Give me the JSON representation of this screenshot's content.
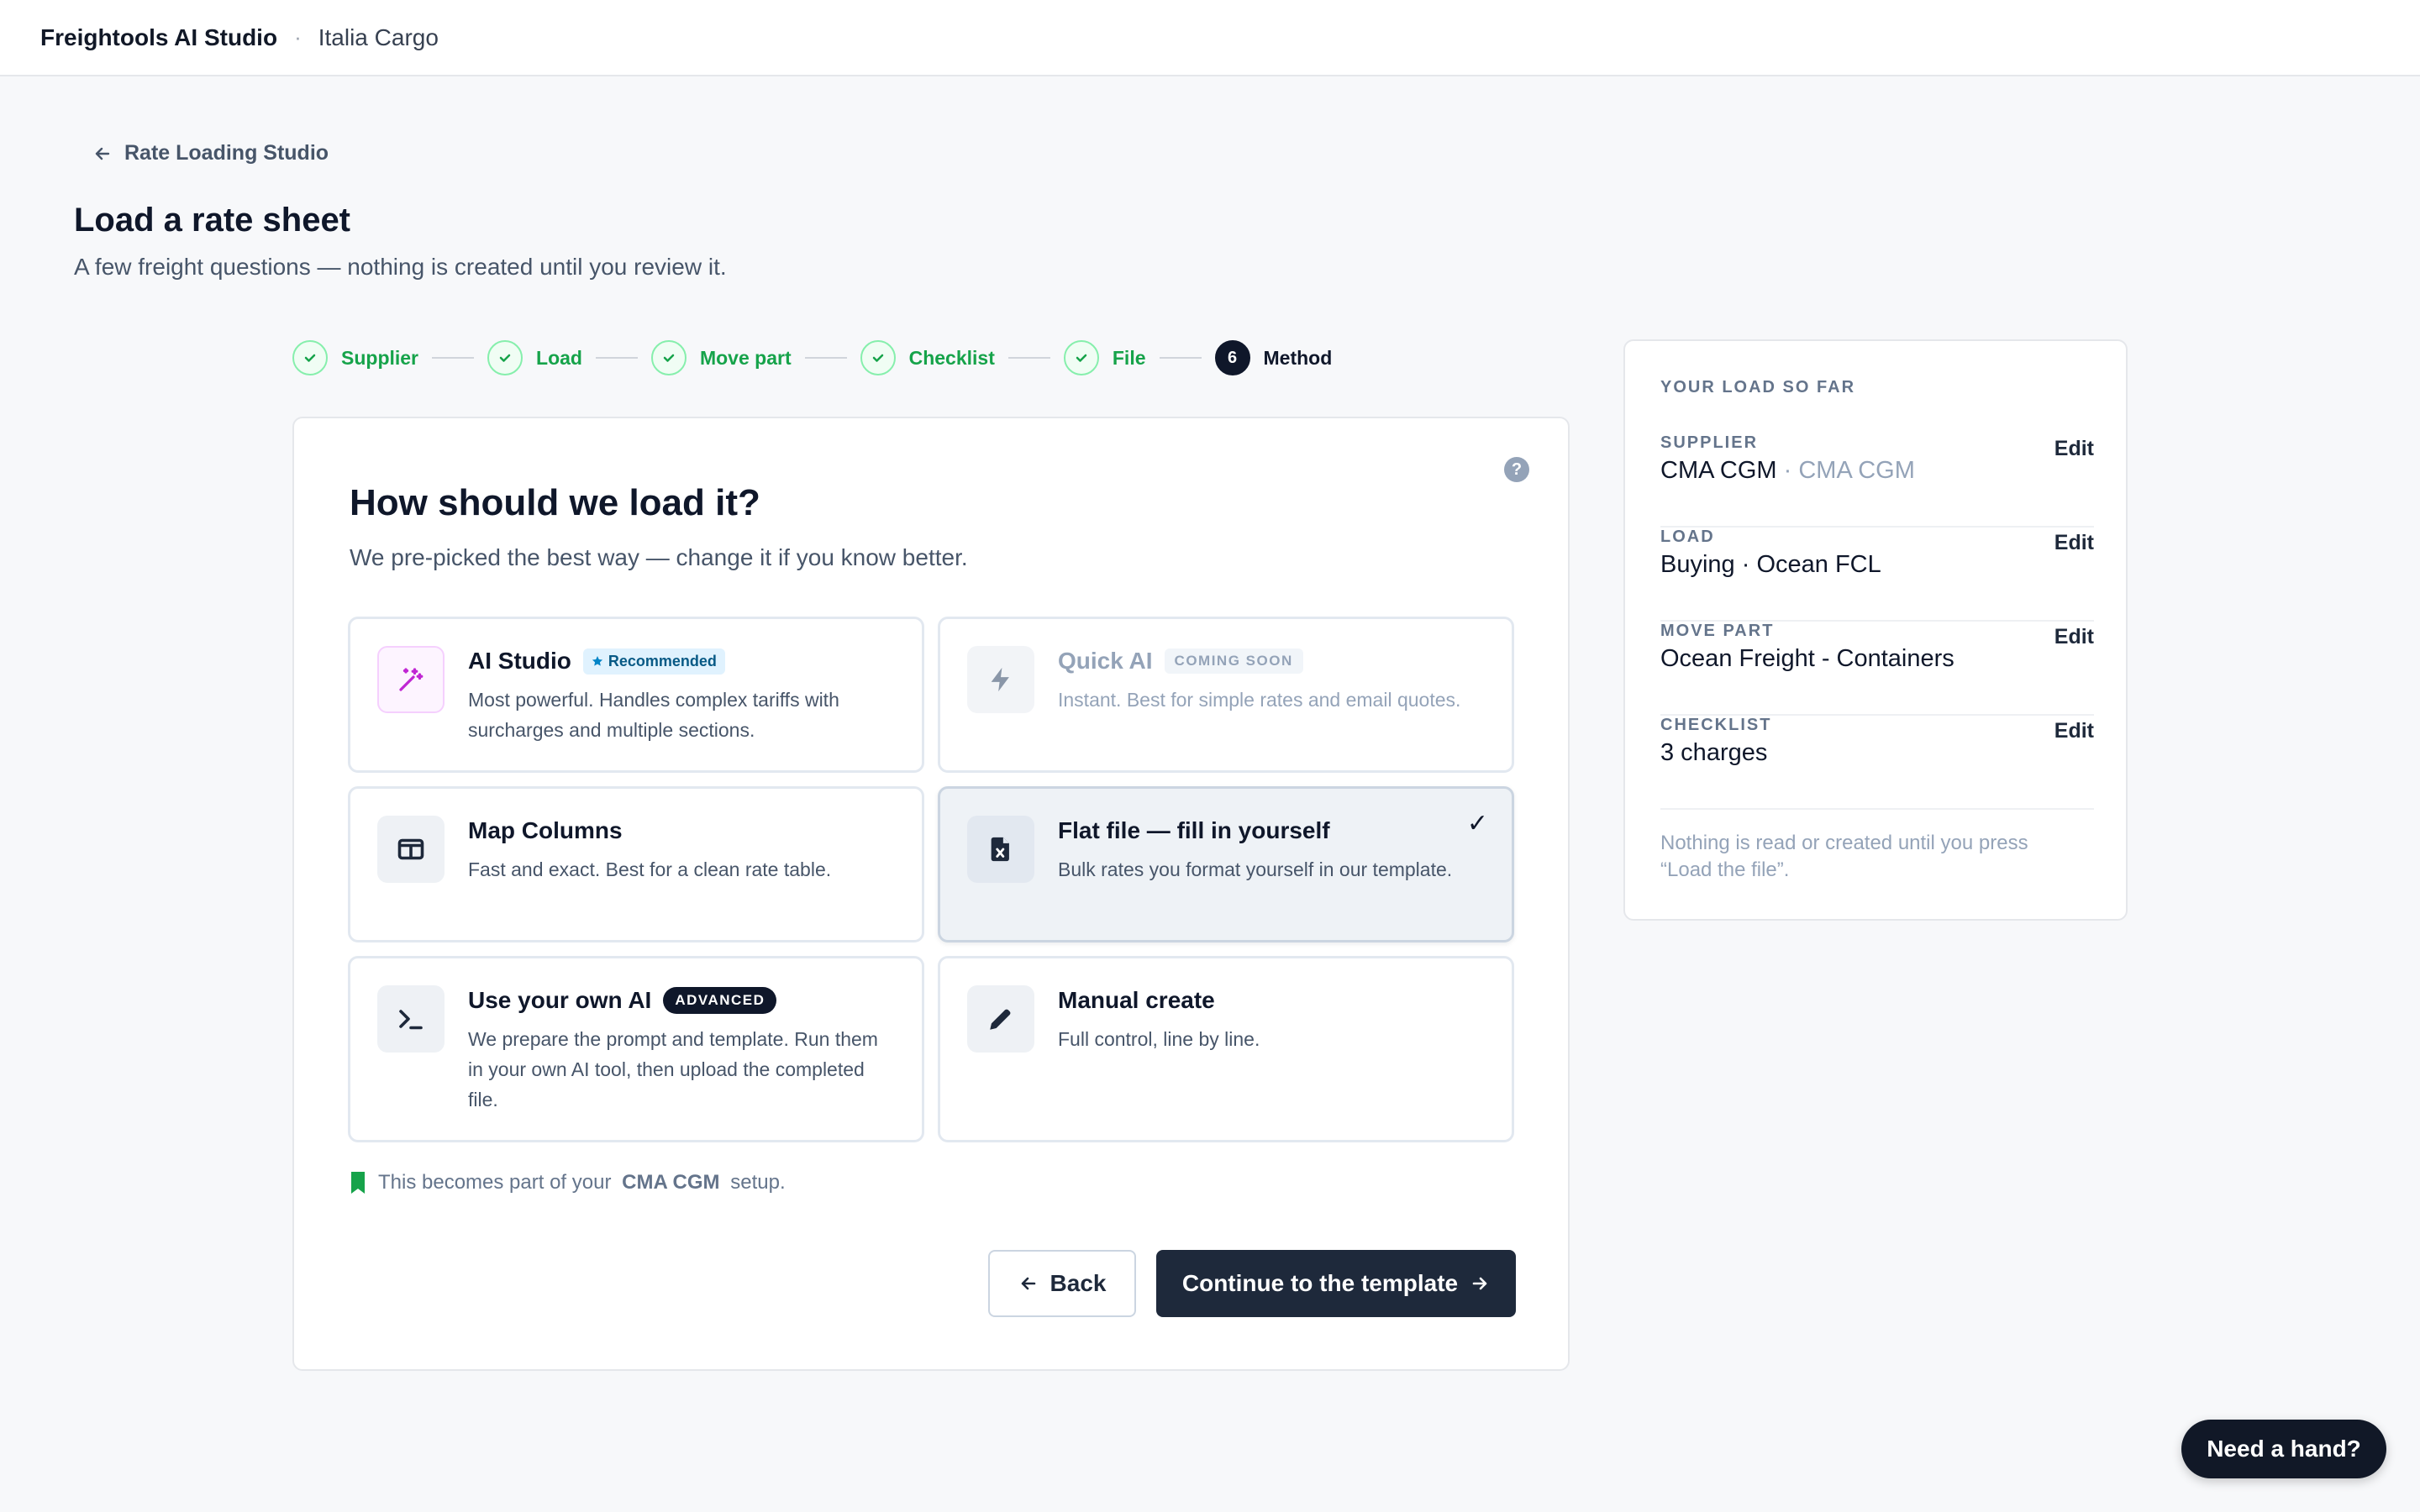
{
  "topbar": {
    "brand": "Freightools AI Studio",
    "separator": "·",
    "org": "Italia Cargo"
  },
  "back_link": {
    "label": "Rate Loading Studio",
    "icon": "arrow-left-icon"
  },
  "page": {
    "title": "Load a rate sheet",
    "subtitle": "A few freight questions — nothing is created until you review it."
  },
  "stepper": {
    "steps": [
      {
        "label": "Supplier",
        "state": "done"
      },
      {
        "label": "Load",
        "state": "done"
      },
      {
        "label": "Move part",
        "state": "done"
      },
      {
        "label": "Checklist",
        "state": "done"
      },
      {
        "label": "File",
        "state": "done"
      },
      {
        "label": "Method",
        "state": "active",
        "number": "6"
      }
    ]
  },
  "method_card": {
    "title": "How should we load it?",
    "subtitle": "We pre-picked the best way — change it if you know better.",
    "help_icon": "?",
    "options": [
      {
        "title": "AI Studio",
        "badge": "Recommended",
        "description": "Most powerful. Handles complex tariffs with surcharges and multiple sections.",
        "icon": "magic-wand-icon"
      },
      {
        "title": "Quick AI",
        "badge": "COMING SOON",
        "description": "Instant. Best for simple rates and email quotes.",
        "icon": "lightning-icon",
        "disabled": true
      },
      {
        "title": "Map Columns",
        "description": "Fast and exact. Best for a clean rate table.",
        "icon": "columns-icon"
      },
      {
        "title": "Flat file — fill in yourself",
        "description": "Bulk rates you format yourself in our template.",
        "icon": "excel-file-icon",
        "selected": true,
        "check": "✓"
      },
      {
        "title": "Use your own AI",
        "badge": "ADVANCED",
        "description": "We prepare the prompt and template. Run them in your own AI tool, then upload the completed file.",
        "icon": "terminal-icon"
      },
      {
        "title": "Manual create",
        "description": "Full control, line by line.",
        "icon": "pencil-icon"
      }
    ],
    "footnote": {
      "prefix": "This becomes part of your",
      "supplier": "CMA CGM",
      "suffix": "setup."
    },
    "back_label": "Back",
    "continue_label": "Continue to the template"
  },
  "summary": {
    "heading": "YOUR LOAD SO FAR",
    "rows": [
      {
        "key": "SUPPLIER",
        "value": "CMA CGM",
        "extra": "· CMA CGM",
        "edit": "Edit"
      },
      {
        "key": "LOAD",
        "value": "Buying · Ocean FCL",
        "edit": "Edit"
      },
      {
        "key": "MOVE PART",
        "value": "Ocean Freight - Containers",
        "edit": "Edit"
      },
      {
        "key": "CHECKLIST",
        "value": "3 charges",
        "edit": "Edit"
      }
    ],
    "note": "Nothing is read or created until you press “Load the file”."
  },
  "help_button": {
    "label": "Need a hand?"
  },
  "colors": {
    "accent_dark": "#1e293b",
    "success": "#16a34a",
    "recommended_bg": "#e0f2fe",
    "purple": "#c026d3"
  }
}
